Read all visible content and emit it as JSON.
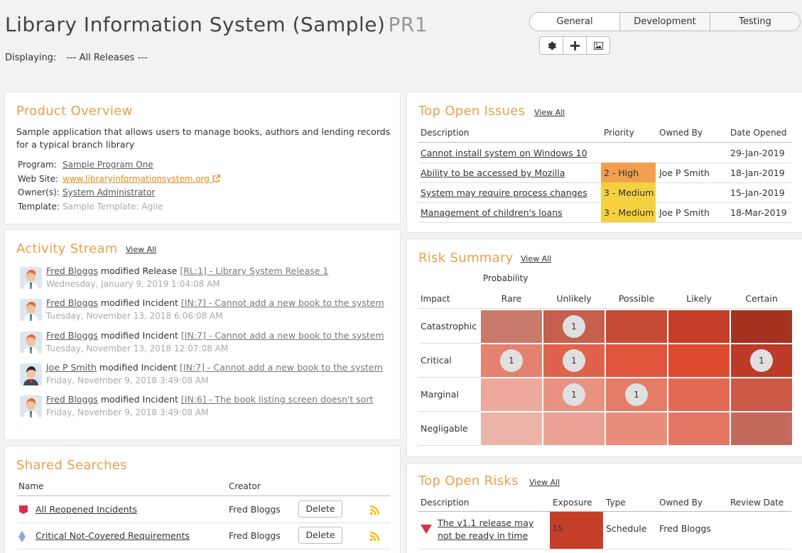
{
  "header": {
    "title": "Library Information System (Sample)",
    "project_id": "PR1",
    "displaying_label": "Displaying:",
    "displaying_value": "--- All Releases ---"
  },
  "tabs": [
    "General",
    "Development",
    "Testing"
  ],
  "toolbar": {
    "icons": [
      "gear-icon",
      "plus-icon",
      "image-icon"
    ]
  },
  "product_overview": {
    "title": "Product Overview",
    "description": "Sample application that allows users to manage books, authors and lending records for a typical branch library",
    "program_label": "Program:",
    "program_value": "Sample Program One",
    "website_label": "Web Site:",
    "website_value": "www.libraryinformationsystem.org",
    "owners_label": "Owner(s):",
    "owners_value": "System Administrator",
    "template_label": "Template:",
    "template_value": "Sample Template: Agile"
  },
  "activity_stream": {
    "title": "Activity Stream",
    "view_all": "View All",
    "items": [
      {
        "user": "Fred Bloggs",
        "action": "modified Release",
        "artifact": "[RL:1] - Library System Release 1",
        "time": "Wednesday, January 9, 2019 1:04:08 AM",
        "avatar": "fred"
      },
      {
        "user": "Fred Bloggs",
        "action": "modified Incident",
        "artifact": "[IN:7] - Cannot add a new book to the system",
        "time": "Tuesday, November 13, 2018 6:06:08 AM",
        "avatar": "fred"
      },
      {
        "user": "Fred Bloggs",
        "action": "modified Incident",
        "artifact": "[IN:7] - Cannot add a new book to the system",
        "time": "Tuesday, November 13, 2018 12:07:08 AM",
        "avatar": "fred"
      },
      {
        "user": "Joe P Smith",
        "action": "modified Incident",
        "artifact": "[IN:7] - Cannot add a new book to the system",
        "time": "Friday, November 9, 2018 3:49:08 AM",
        "avatar": "joe"
      },
      {
        "user": "Fred Bloggs",
        "action": "modified Incident",
        "artifact": "[IN:6] - The book listing screen doesn't sort",
        "time": "Friday, November 9, 2018 3:49:08 AM",
        "avatar": "fred"
      }
    ]
  },
  "shared_searches": {
    "title": "Shared Searches",
    "columns": [
      "Name",
      "Creator"
    ],
    "rows": [
      {
        "name": "All Reopened Incidents",
        "creator": "Fred Bloggs",
        "delete_label": "Delete",
        "icon": "incident-flag-icon",
        "icon_color": "#d9304a"
      },
      {
        "name": "Critical Not-Covered Requirements",
        "creator": "Fred Bloggs",
        "delete_label": "Delete",
        "icon": "requirement-diamond-icon",
        "icon_color": "#8aa8d8"
      }
    ]
  },
  "top_open_issues": {
    "title": "Top Open Issues",
    "view_all": "View All",
    "columns": [
      "Description",
      "Priority",
      "Owned By",
      "Date Opened"
    ],
    "rows": [
      {
        "description": "Cannot install system on Windows 10",
        "priority": "",
        "priority_color": "",
        "owner": "",
        "date": "29-Jan-2019"
      },
      {
        "description": "Ability to be accessed by Mozilla",
        "priority": "2 - High",
        "priority_color": "#f0a050",
        "owner": "Joe P Smith",
        "date": "18-Jan-2019"
      },
      {
        "description": "System may require process changes",
        "priority": "3 - Medium",
        "priority_color": "#f5d040",
        "owner": "",
        "date": "15-Jan-2019"
      },
      {
        "description": "Management of children's loans",
        "priority": "3 - Medium",
        "priority_color": "#f5d040",
        "owner": "Joe P Smith",
        "date": "18-Mar-2019"
      }
    ]
  },
  "risk_summary": {
    "title": "Risk Summary",
    "view_all": "View All",
    "probability_label": "Probability",
    "impact_label": "Impact",
    "probabilities": [
      "Rare",
      "Unlikely",
      "Possible",
      "Likely",
      "Certain"
    ],
    "impacts": [
      "Catastrophic",
      "Critical",
      "Marginal",
      "Negligable"
    ],
    "colors": [
      [
        "#c97a6c",
        "#c55f4e",
        "#c54a36",
        "#c43e28",
        "#a33320"
      ],
      [
        "#e48270",
        "#e0624c",
        "#e0543e",
        "#dd4a30",
        "#bd3a28"
      ],
      [
        "#eda99c",
        "#e9927f",
        "#e57c68",
        "#e26a55",
        "#cc5a46"
      ],
      [
        "#ecb3a8",
        "#eba193",
        "#e98e7c",
        "#e57664",
        "#c46a5c"
      ]
    ],
    "counts": [
      [
        0,
        1,
        0,
        0,
        0
      ],
      [
        1,
        1,
        0,
        0,
        1
      ],
      [
        0,
        1,
        1,
        0,
        0
      ],
      [
        0,
        0,
        0,
        0,
        0
      ]
    ]
  },
  "top_open_risks": {
    "title": "Top Open Risks",
    "view_all": "View All",
    "columns": [
      "Description",
      "Exposure",
      "Type",
      "Owned By",
      "Review Date"
    ],
    "rows": [
      {
        "description": "The v1.1 release may not be ready in time",
        "exposure": "15",
        "exposure_color": "#c43e28",
        "type": "Schedule",
        "owner": "Fred Bloggs",
        "review_date": ""
      }
    ]
  }
}
